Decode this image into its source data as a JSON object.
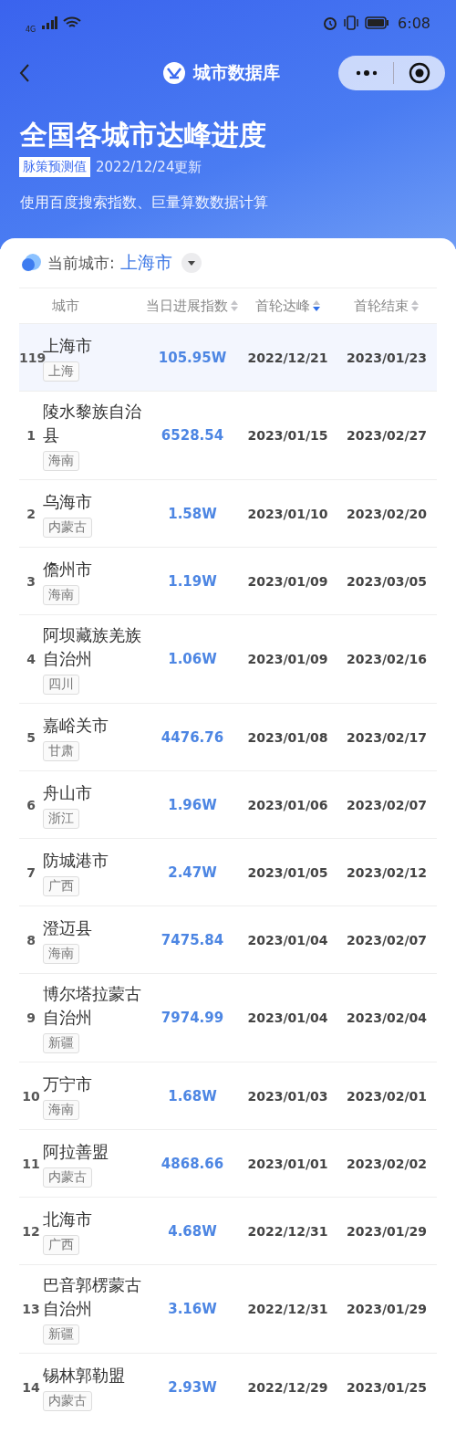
{
  "status_bar": {
    "network": "4G",
    "time": "6:08"
  },
  "nav": {
    "title": "城市数据库"
  },
  "header": {
    "title": "全国各城市达峰进度",
    "badge": "脉策预测值",
    "updated": "2022/12/24更新",
    "note": "使用百度搜索指数、巨量算数数据计算"
  },
  "city_picker": {
    "label": "当前城市:",
    "value": "上海市"
  },
  "table": {
    "columns": [
      {
        "label": "城市",
        "sortable": false
      },
      {
        "label": "当日进展指数",
        "sortable": true,
        "sorted_desc": false
      },
      {
        "label": "首轮达峰",
        "sortable": true,
        "sorted_desc": true
      },
      {
        "label": "首轮结束",
        "sortable": true,
        "sorted_desc": false
      }
    ],
    "rows": [
      {
        "rank": "119",
        "city": "上海市",
        "province": "上海",
        "index": "105.95W",
        "peak": "2022/12/21",
        "end": "2023/01/23",
        "selected": true
      },
      {
        "rank": "1",
        "city": "陵水黎族自治县",
        "province": "海南",
        "index": "6528.54",
        "peak": "2023/01/15",
        "end": "2023/02/27",
        "selected": false
      },
      {
        "rank": "2",
        "city": "乌海市",
        "province": "内蒙古",
        "index": "1.58W",
        "peak": "2023/01/10",
        "end": "2023/02/20",
        "selected": false
      },
      {
        "rank": "3",
        "city": "儋州市",
        "province": "海南",
        "index": "1.19W",
        "peak": "2023/01/09",
        "end": "2023/03/05",
        "selected": false
      },
      {
        "rank": "4",
        "city": "阿坝藏族羌族自治州",
        "province": "四川",
        "index": "1.06W",
        "peak": "2023/01/09",
        "end": "2023/02/16",
        "selected": false
      },
      {
        "rank": "5",
        "city": "嘉峪关市",
        "province": "甘肃",
        "index": "4476.76",
        "peak": "2023/01/08",
        "end": "2023/02/17",
        "selected": false
      },
      {
        "rank": "6",
        "city": "舟山市",
        "province": "浙江",
        "index": "1.96W",
        "peak": "2023/01/06",
        "end": "2023/02/07",
        "selected": false
      },
      {
        "rank": "7",
        "city": "防城港市",
        "province": "广西",
        "index": "2.47W",
        "peak": "2023/01/05",
        "end": "2023/02/12",
        "selected": false
      },
      {
        "rank": "8",
        "city": "澄迈县",
        "province": "海南",
        "index": "7475.84",
        "peak": "2023/01/04",
        "end": "2023/02/07",
        "selected": false
      },
      {
        "rank": "9",
        "city": "博尔塔拉蒙古自治州",
        "province": "新疆",
        "index": "7974.99",
        "peak": "2023/01/04",
        "end": "2023/02/04",
        "selected": false
      },
      {
        "rank": "10",
        "city": "万宁市",
        "province": "海南",
        "index": "1.68W",
        "peak": "2023/01/03",
        "end": "2023/02/01",
        "selected": false
      },
      {
        "rank": "11",
        "city": "阿拉善盟",
        "province": "内蒙古",
        "index": "4868.66",
        "peak": "2023/01/01",
        "end": "2023/02/02",
        "selected": false
      },
      {
        "rank": "12",
        "city": "北海市",
        "province": "广西",
        "index": "4.68W",
        "peak": "2022/12/31",
        "end": "2023/01/29",
        "selected": false
      },
      {
        "rank": "13",
        "city": "巴音郭楞蒙古自治州",
        "province": "新疆",
        "index": "3.16W",
        "peak": "2022/12/31",
        "end": "2023/01/29",
        "selected": false
      },
      {
        "rank": "14",
        "city": "锡林郭勒盟",
        "province": "内蒙古",
        "index": "2.93W",
        "peak": "2022/12/29",
        "end": "2023/01/25",
        "selected": false
      }
    ]
  }
}
